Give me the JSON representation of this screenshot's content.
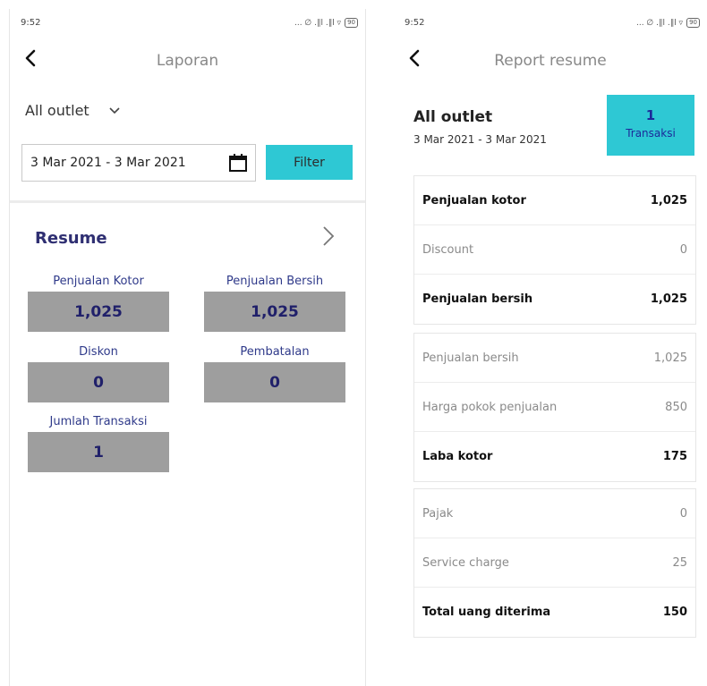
{
  "left_screen": {
    "status_time": "9:52",
    "status_icons": "... ∅ .∥l .∥l ▿",
    "battery": "90",
    "title": "Laporan",
    "outlet_select": "All outlet",
    "date_range": "3 Mar 2021 - 3 Mar 2021",
    "filter_label": "Filter",
    "resume_title": "Resume",
    "cards": [
      {
        "label": "Penjualan Kotor",
        "value": "1,025"
      },
      {
        "label": "Penjualan Bersih",
        "value": "1,025"
      },
      {
        "label": "Diskon",
        "value": "0"
      },
      {
        "label": "Pembatalan",
        "value": "0"
      },
      {
        "label": "Jumlah Transaksi",
        "value": "1"
      }
    ]
  },
  "right_screen": {
    "status_time": "9:52",
    "status_icons": "... ∅ .∥l .∥l ▿",
    "battery": "90",
    "title": "Report resume",
    "outlet": "All outlet",
    "date_range": "3 Mar 2021 - 3 Mar 2021",
    "transaksi_count": "1",
    "transaksi_label": "Transaksi",
    "groups": [
      [
        {
          "label": "Penjualan kotor",
          "value": "1,025",
          "style": "bold"
        },
        {
          "label": "Discount",
          "value": "0",
          "style": "light"
        },
        {
          "label": "Penjualan bersih",
          "value": "1,025",
          "style": "bold"
        }
      ],
      [
        {
          "label": "Penjualan bersih",
          "value": "1,025",
          "style": "light"
        },
        {
          "label": "Harga pokok penjualan",
          "value": "850",
          "style": "light"
        },
        {
          "label": "Laba kotor",
          "value": "175",
          "style": "bold"
        }
      ],
      [
        {
          "label": "Pajak",
          "value": "0",
          "style": "light"
        },
        {
          "label": "Service charge",
          "value": "25",
          "style": "light"
        },
        {
          "label": "Total uang diterima",
          "value": "150",
          "style": "bold"
        }
      ]
    ]
  },
  "colors": {
    "accent": "#2ec8d4",
    "card_bg": "#9e9e9e",
    "navy": "#2f2f72"
  }
}
